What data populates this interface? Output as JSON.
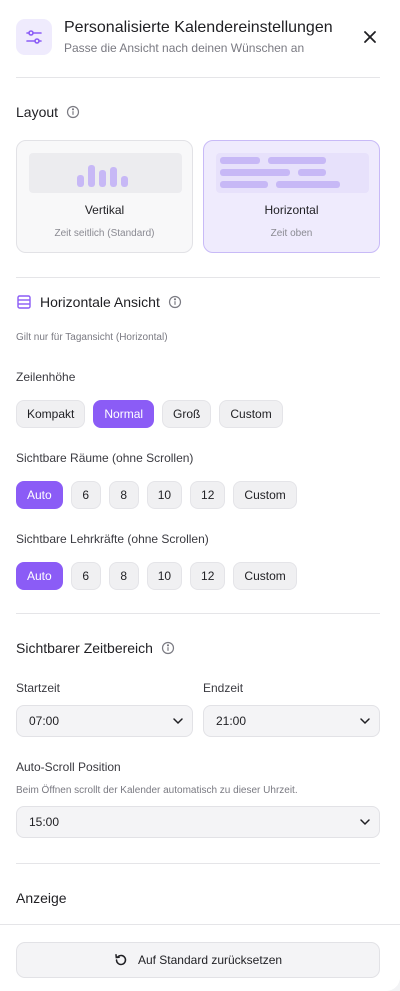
{
  "header": {
    "title": "Personalisierte Kalendereinstellungen",
    "subtitle": "Passe die Ansicht nach deinen Wünschen an",
    "icon": "sliders-icon",
    "close_icon": "close-icon"
  },
  "layout": {
    "title": "Layout",
    "options": [
      {
        "label": "Vertikal",
        "sub": "Zeit seitlich (Standard)",
        "active": false
      },
      {
        "label": "Horizontal",
        "sub": "Zeit oben",
        "active": true
      }
    ]
  },
  "horizontal": {
    "title": "Horizontale Ansicht",
    "hint": "Gilt nur für Tagansicht (Horizontal)",
    "row_height": {
      "label": "Zeilenhöhe",
      "options": [
        "Kompakt",
        "Normal",
        "Groß",
        "Custom"
      ],
      "selected": "Normal"
    },
    "rooms": {
      "label": "Sichtbare Räume (ohne Scrollen)",
      "options": [
        "Auto",
        "6",
        "8",
        "10",
        "12",
        "Custom"
      ],
      "selected": "Auto"
    },
    "teachers": {
      "label": "Sichtbare Lehrkräfte (ohne Scrollen)",
      "options": [
        "Auto",
        "6",
        "8",
        "10",
        "12",
        "Custom"
      ],
      "selected": "Auto"
    }
  },
  "time_range": {
    "title": "Sichtbarer Zeitbereich",
    "start_label": "Startzeit",
    "start_value": "07:00",
    "end_label": "Endzeit",
    "end_value": "21:00",
    "autoscroll_label": "Auto-Scroll Position",
    "autoscroll_hint": "Beim Öffnen scrollt der Kalender automatisch zu dieser Uhrzeit.",
    "autoscroll_value": "15:00"
  },
  "display": {
    "title": "Anzeige"
  },
  "footer": {
    "reset_label": "Auf Standard zurücksetzen"
  },
  "colors": {
    "accent": "#8b5cf6",
    "accent_light": "#efebfd"
  }
}
